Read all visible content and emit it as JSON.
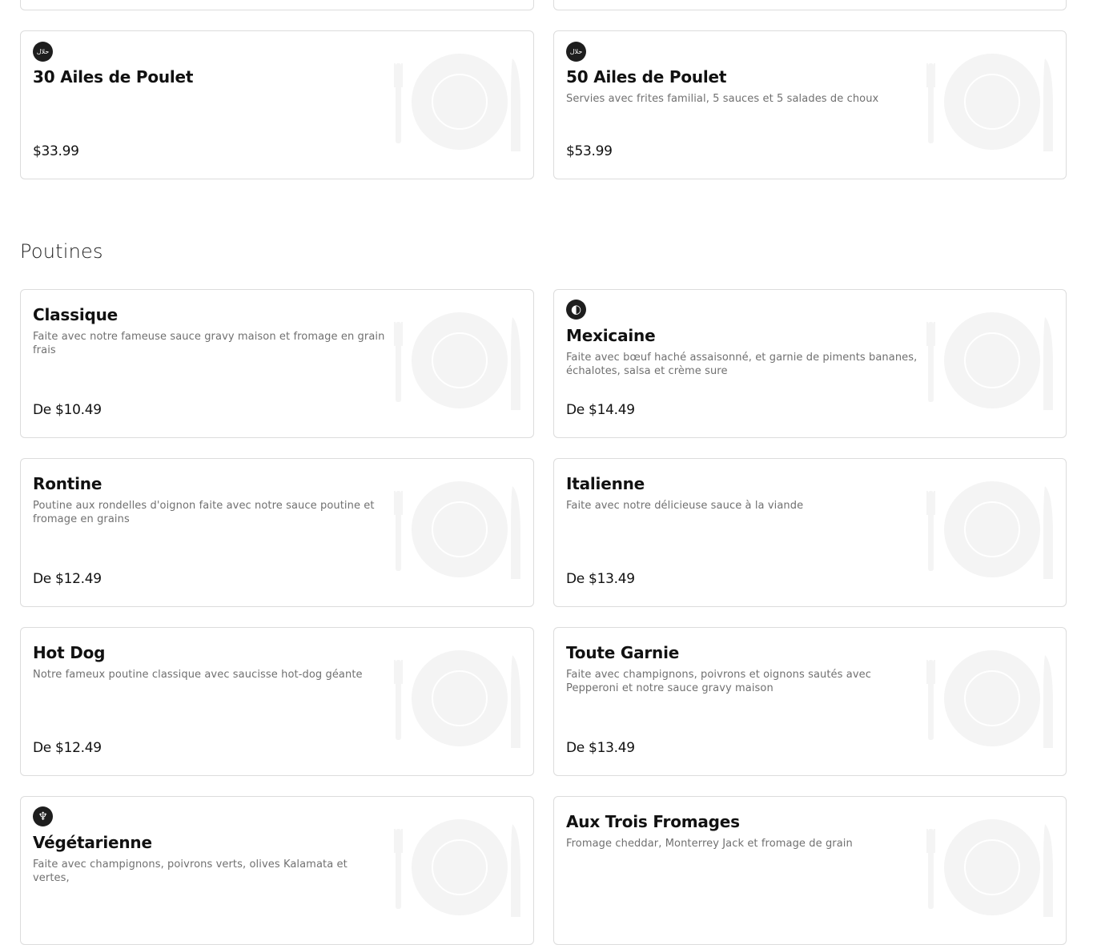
{
  "sections": [
    {
      "title": "",
      "items": [
        {
          "title": "30 Ailes de Poulet",
          "description": "",
          "price": "$33.99",
          "icon": "halal-icon"
        },
        {
          "title": "50 Ailes de Poulet",
          "description": "Servies avec frites familial, 5 sauces et 5 salades de choux",
          "price": "$53.99",
          "icon": "halal-icon"
        }
      ]
    },
    {
      "title": "Poutines",
      "items": [
        {
          "title": "Classique",
          "description": "Faite avec notre fameuse sauce gravy maison et fromage en grain frais",
          "price": "De $10.49"
        },
        {
          "title": "Mexicaine",
          "description": "Faite avec bœuf haché assaisonné, et garnie de piments bananes, échalotes, salsa et crème sure",
          "price": "De $14.49",
          "icon": "spicy-icon"
        },
        {
          "title": "Rontine",
          "description": "Poutine aux rondelles d'oignon faite avec notre sauce poutine et fromage en grains",
          "price": "De $12.49"
        },
        {
          "title": "Italienne",
          "description": "Faite avec notre délicieuse sauce à la viande",
          "price": "De $13.49"
        },
        {
          "title": "Hot Dog",
          "description": "Notre fameux poutine classique avec saucisse hot-dog géante",
          "price": "De $12.49"
        },
        {
          "title": "Toute Garnie",
          "description": "Faite avec champignons, poivrons et oignons sautés avec Pepperoni et notre sauce gravy maison",
          "price": "De $13.49"
        },
        {
          "title": "Végétarienne",
          "description": "Faite avec champignons, poivrons verts, olives Kalamata et vertes,",
          "price": "",
          "icon": "vegetarian-icon"
        },
        {
          "title": "Aux Trois Fromages",
          "description": "Fromage cheddar, Monterrey Jack et fromage de grain",
          "price": ""
        }
      ]
    }
  ],
  "icons": {
    "halal_text": "حلال",
    "spicy_glyph": "◐",
    "vegetarian_glyph": "♆"
  },
  "colors": {
    "card_border": "#dcdcdc",
    "title": "#111111",
    "description": "#707070",
    "plate": "#f4f4f4",
    "badge": "#1e1e1e"
  }
}
